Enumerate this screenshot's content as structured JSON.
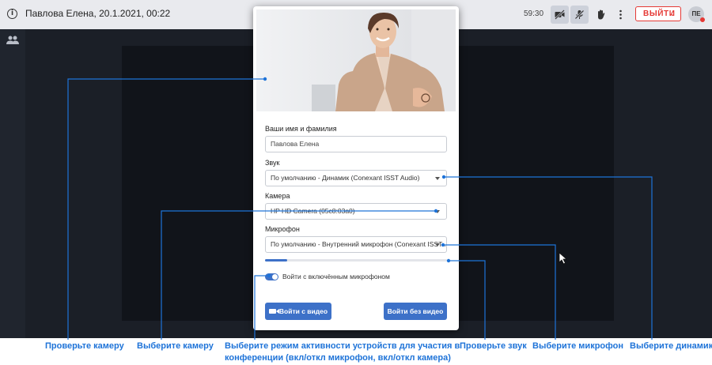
{
  "topbar": {
    "meeting_title": "Павлова Елена, 20.1.2021, 00:22",
    "timer": "59:30",
    "exit_label": "ВЫЙТИ",
    "avatar_initials": "ПЕ",
    "icons": [
      "info-icon",
      "video-off-icon",
      "mic-off-icon",
      "raise-hand-icon",
      "more-vert-icon",
      "chevron-down-icon"
    ],
    "accent_color": "#e53935"
  },
  "sidebar": {
    "icons": [
      "participants-icon"
    ]
  },
  "dialog": {
    "name_label": "Ваши имя и фамилия",
    "name_value": "Павлова Елена",
    "sound_label": "Звук",
    "sound_value": "По умолчанию - Динамик (Conexant ISST Audio)",
    "camera_label": "Камера",
    "camera_value": "HP HD Camera (05c8:03a0)",
    "mic_label": "Микрофон",
    "mic_value": "По умолчанию - Внутренний микрофон (Conexant ISST ...",
    "mic_level": 0.12,
    "toggle_label": "Войти с включённым микрофоном",
    "toggle_on": true,
    "join_video_label": "Войти с видео",
    "join_no_video_label": "Войти без видео",
    "button_color": "#3d71c8"
  },
  "callouts": {
    "camera_check": "Проверьте камеру",
    "camera_select": "Выберите камеру",
    "mode_line1": "Выберите режим активности устройств для участия в",
    "mode_line2": "конференции (вкл/откл микрофон, вкл/откл камера)",
    "sound_check": "Проверьте звук",
    "mic_select": "Выберите микрофон",
    "speaker_select": "Выберите динамик",
    "line_color": "#1e73d8"
  }
}
